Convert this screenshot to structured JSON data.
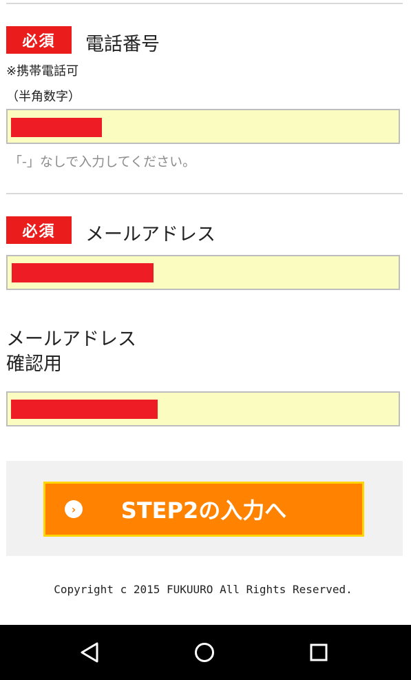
{
  "phone": {
    "required_badge": "必須",
    "label": "電話番号",
    "note1": "※携帯電話可",
    "note2": "（半角数字）",
    "hint": "「-」なしで入力してください。"
  },
  "email": {
    "required_badge": "必須",
    "label": "メールアドレス"
  },
  "email_confirm": {
    "label_line1": "メールアドレス",
    "label_line2": "確認用"
  },
  "submit": {
    "label": "STEP2の入力へ",
    "icon": "chevron-circle-right-icon"
  },
  "footer": {
    "copyright": "Copyright c 2015 FUKUURO All Rights Reserved."
  },
  "navbar": {
    "icons": [
      "back-icon",
      "home-icon",
      "recent-apps-icon"
    ]
  },
  "colors": {
    "required_badge": "#ea1c1c",
    "field_background": "#fafcc0",
    "redaction": "#ee1c24",
    "button": "#ff8200",
    "button_border": "#ffd400",
    "submit_area": "#f1f1f1"
  }
}
